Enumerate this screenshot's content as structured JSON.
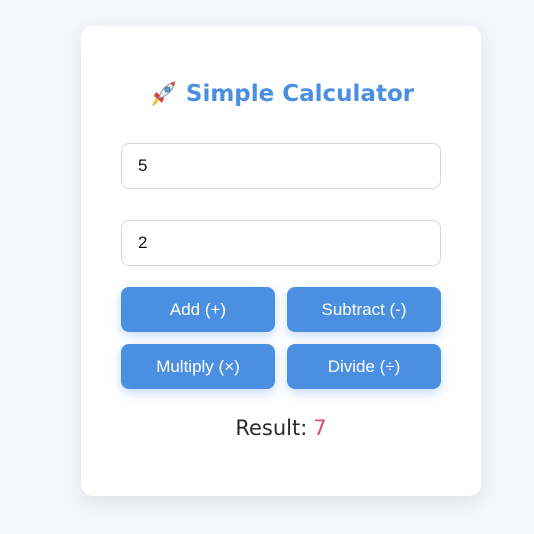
{
  "header": {
    "title": "Simple Calculator",
    "icon": "rocket-icon"
  },
  "inputs": {
    "first_value": "5",
    "second_value": "2"
  },
  "buttons": {
    "add": "Add (+)",
    "subtract": "Subtract (-)",
    "multiply": "Multiply (×)",
    "divide": "Divide (÷)"
  },
  "result": {
    "label": "Result:",
    "value": "7"
  },
  "colors": {
    "accent": "#4a8fe0",
    "result_value": "#e24b6a",
    "background": "#f4f6fa"
  }
}
